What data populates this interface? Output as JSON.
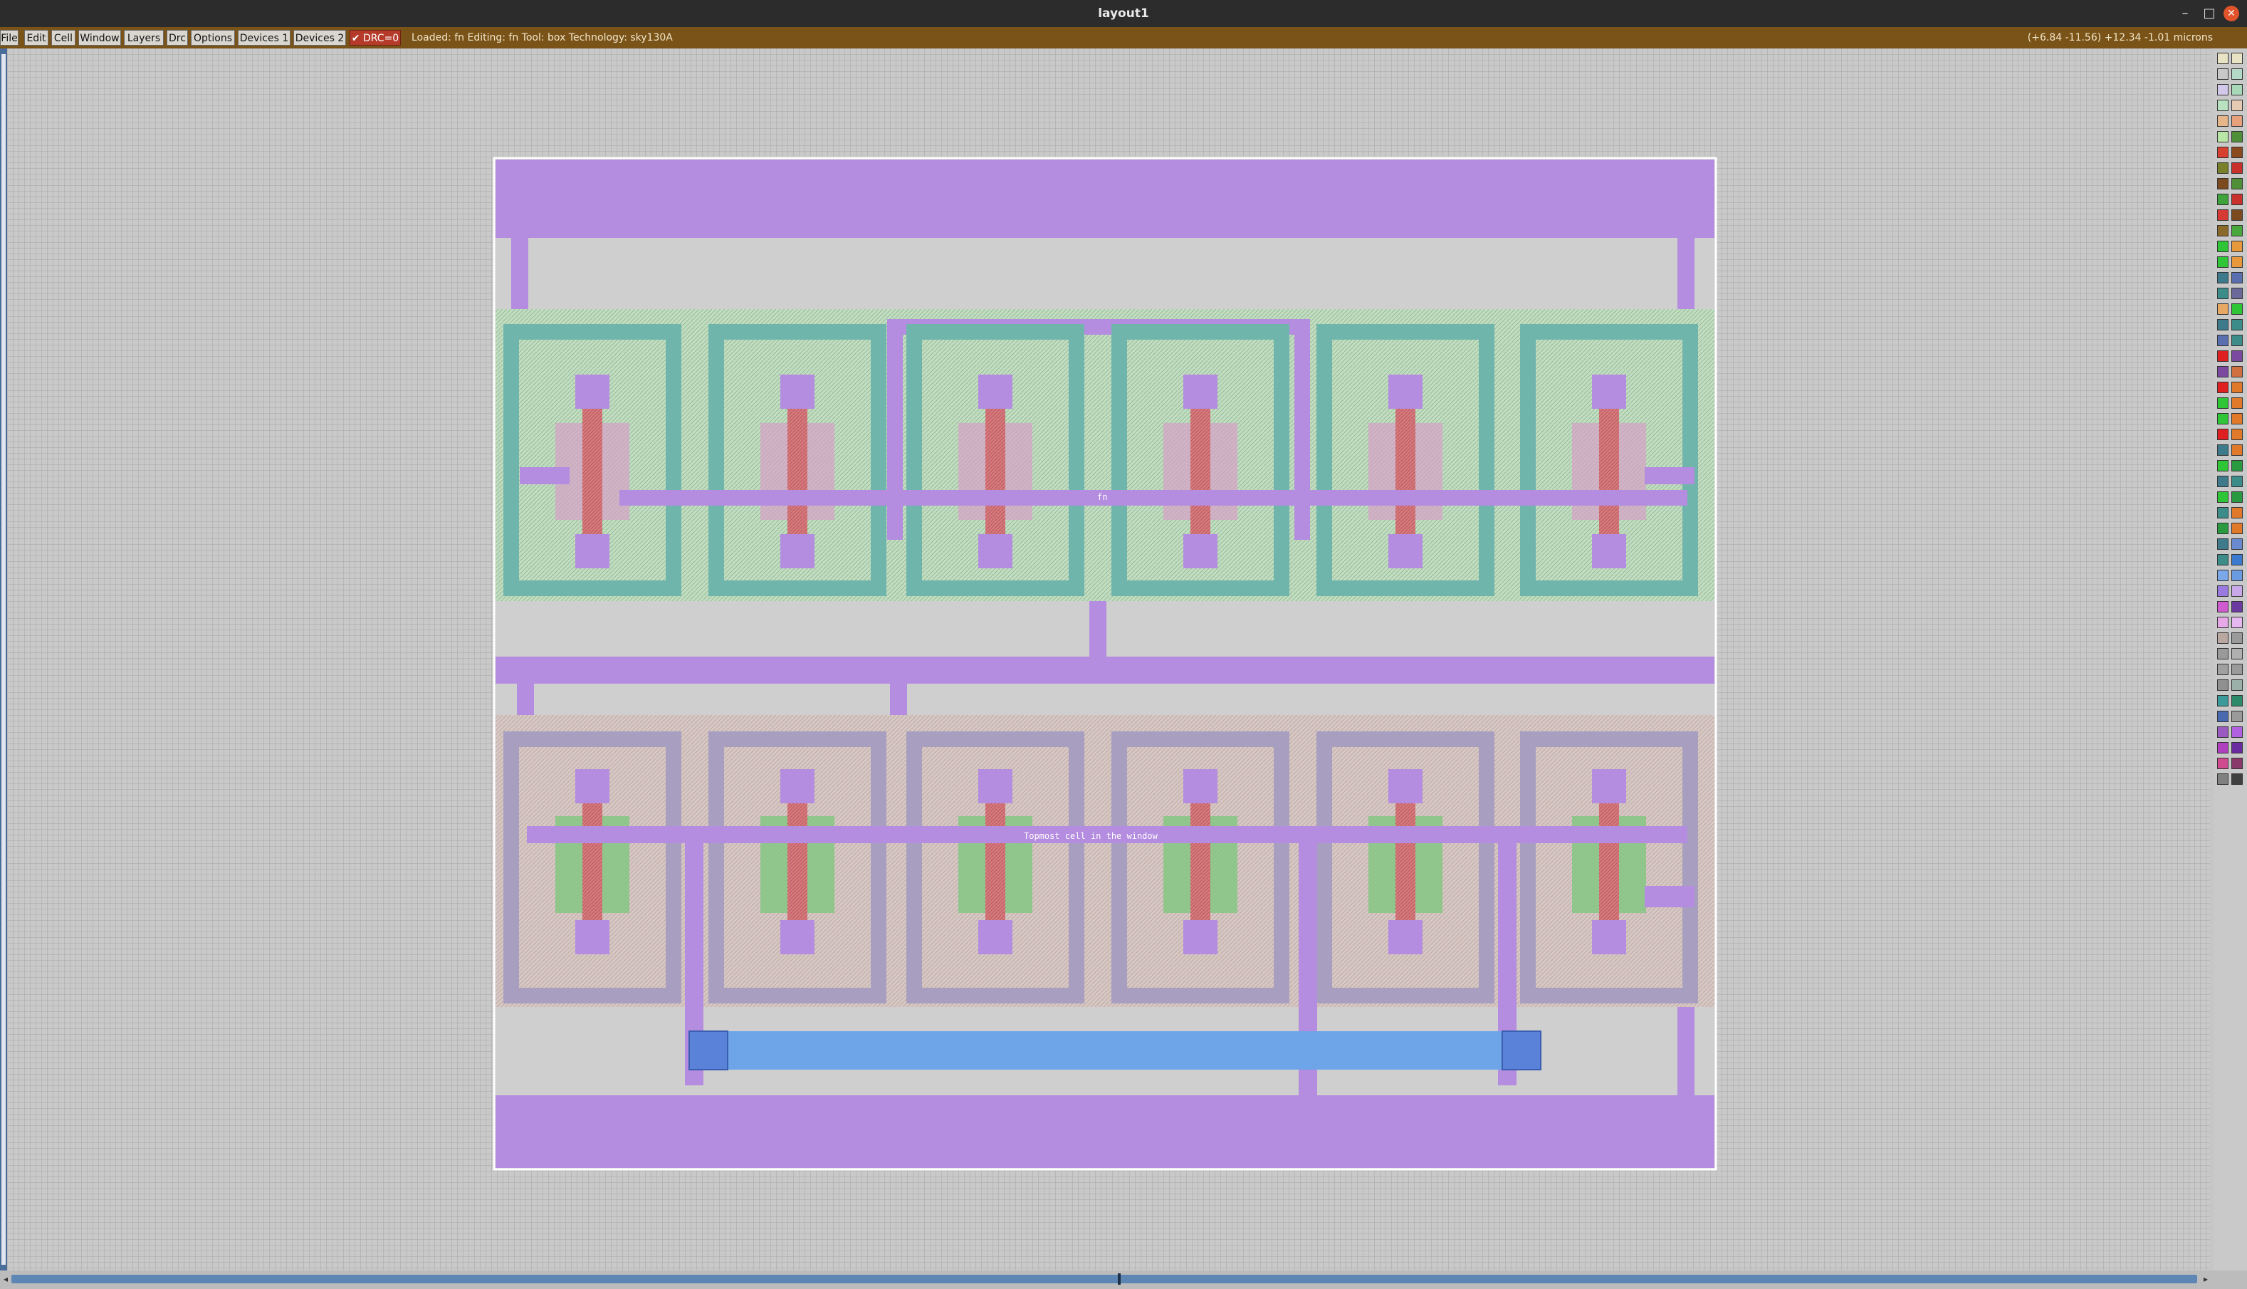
{
  "window": {
    "title": "layout1",
    "controls": [
      "–",
      "□",
      "✕"
    ]
  },
  "menu": {
    "items": [
      "File",
      "Edit",
      "Cell",
      "Window",
      "Layers",
      "Drc",
      "Options",
      "Devices 1",
      "Devices 2"
    ],
    "drc_label": "✔ DRC=0"
  },
  "status": {
    "message": "Loaded: fn Editing: fn Tool: box  Technology: sky130A",
    "coordinates": "(+6.84 -11.56) +12.34 -1.01 microns"
  },
  "layout": {
    "label_top": "fn",
    "label_bottom": "Topmost cell in the window"
  },
  "colors": {
    "metal1": "#b48ce0",
    "poly": "#d77a7e",
    "ndiff_bg": "#bfe0bf",
    "ring": "#6fb5ac",
    "pdiff_bg": "#d8c7c2",
    "ring_gray": "#a89fc0",
    "metal2": "#6ea4e8"
  },
  "palette_colors": [
    [
      "#e8e3c4",
      "#e8e3c4"
    ],
    [
      "#c8c8c8",
      "#b5d9c7"
    ],
    [
      "#d2c8ea",
      "#a7d8b8"
    ],
    [
      "#b8e2c0",
      "#e6c9b3"
    ],
    [
      "#e6b58a",
      "#e6a07c"
    ],
    [
      "#b8e6a5",
      "#4f8f37"
    ],
    [
      "#d74030",
      "#8a4a1e"
    ],
    [
      "#7a7f2a",
      "#c9322c"
    ],
    [
      "#7b4a1e",
      "#4f8f37"
    ],
    [
      "#3ea33a",
      "#c9322c"
    ],
    [
      "#d73a34",
      "#7b4a1e"
    ],
    [
      "#8a6a2a",
      "#48a83c"
    ],
    [
      "#2ec637",
      "#e7983a"
    ],
    [
      "#2ec637",
      "#e7983a"
    ],
    [
      "#3c7a8c",
      "#5a6fb0"
    ],
    [
      "#3c8c8a",
      "#6a6a9a"
    ],
    [
      "#e6a862",
      "#2ec637"
    ],
    [
      "#3c7a8c",
      "#3c8c8a"
    ],
    [
      "#5a6fb0",
      "#3c8c8a"
    ],
    [
      "#e02020",
      "#7b4aa0"
    ],
    [
      "#7b4aa0",
      "#d07040"
    ],
    [
      "#e02020",
      "#e07a2a"
    ],
    [
      "#2ec637",
      "#e07a2a"
    ],
    [
      "#2ec637",
      "#e07a2a"
    ],
    [
      "#e02020",
      "#e07a2a"
    ],
    [
      "#3c7a8c",
      "#e07a2a"
    ],
    [
      "#2ec637",
      "#2a9a40"
    ],
    [
      "#3c7a8c",
      "#3c8c8a"
    ],
    [
      "#2ec637",
      "#2a9a40"
    ],
    [
      "#3c8c8a",
      "#e07a2a"
    ],
    [
      "#2a9a40",
      "#e07a2a"
    ],
    [
      "#3c7a8c",
      "#6a8ad0"
    ],
    [
      "#3c8c8a",
      "#3c7ad0"
    ],
    [
      "#7aa8e8",
      "#6a9ae0"
    ],
    [
      "#9a7ae0",
      "#c8a8e8"
    ],
    [
      "#d05ad0",
      "#6a3aa0"
    ],
    [
      "#e6a8e6",
      "#e6b8f0"
    ],
    [
      "#b8a8a0",
      "#9a9a9a"
    ],
    [
      "#9a9a9a",
      "#b0b0b0"
    ],
    [
      "#a0a0a0",
      "#9a9a9a"
    ],
    [
      "#909090",
      "#9ab0a8"
    ],
    [
      "#3c9a9a",
      "#2a8a6a"
    ],
    [
      "#4a6ab0",
      "#9a9a9a"
    ],
    [
      "#9a5ac0",
      "#b060e0"
    ],
    [
      "#b040c0",
      "#6a2aa0"
    ],
    [
      "#d04a90",
      "#8a3a6a"
    ],
    [
      "#808080",
      "#404040"
    ]
  ]
}
